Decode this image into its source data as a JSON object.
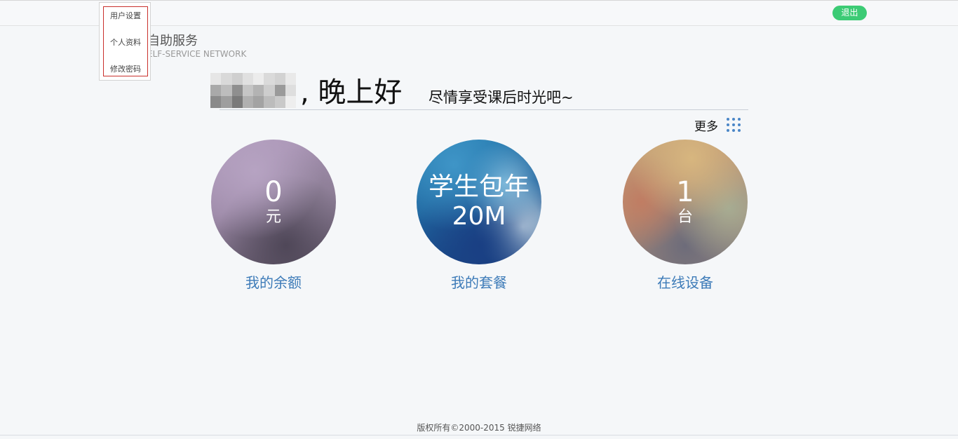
{
  "header": {
    "logout_label": "退出",
    "accent_color": "#3ccb75"
  },
  "user_menu": {
    "items": [
      "用户设置",
      "个人资料",
      "修改密码"
    ]
  },
  "brand": {
    "title": "自助服务",
    "subtitle": "ELF-SERVICE NETWORK"
  },
  "welcome": {
    "greeting": ", 晚上好",
    "tagline": "尽情享受课后时光吧~"
  },
  "more": {
    "label": "更多",
    "icon": "grid-dots-icon"
  },
  "cards": [
    {
      "value": "0",
      "unit": "元",
      "label": "我的余额"
    },
    {
      "line1": "学生包年",
      "line2": "20M",
      "label": "我的套餐"
    },
    {
      "value": "1",
      "unit": "台",
      "label": "在线设备"
    }
  ],
  "footer": {
    "copyright": "版权所有©2000-2015 锐捷网络"
  }
}
